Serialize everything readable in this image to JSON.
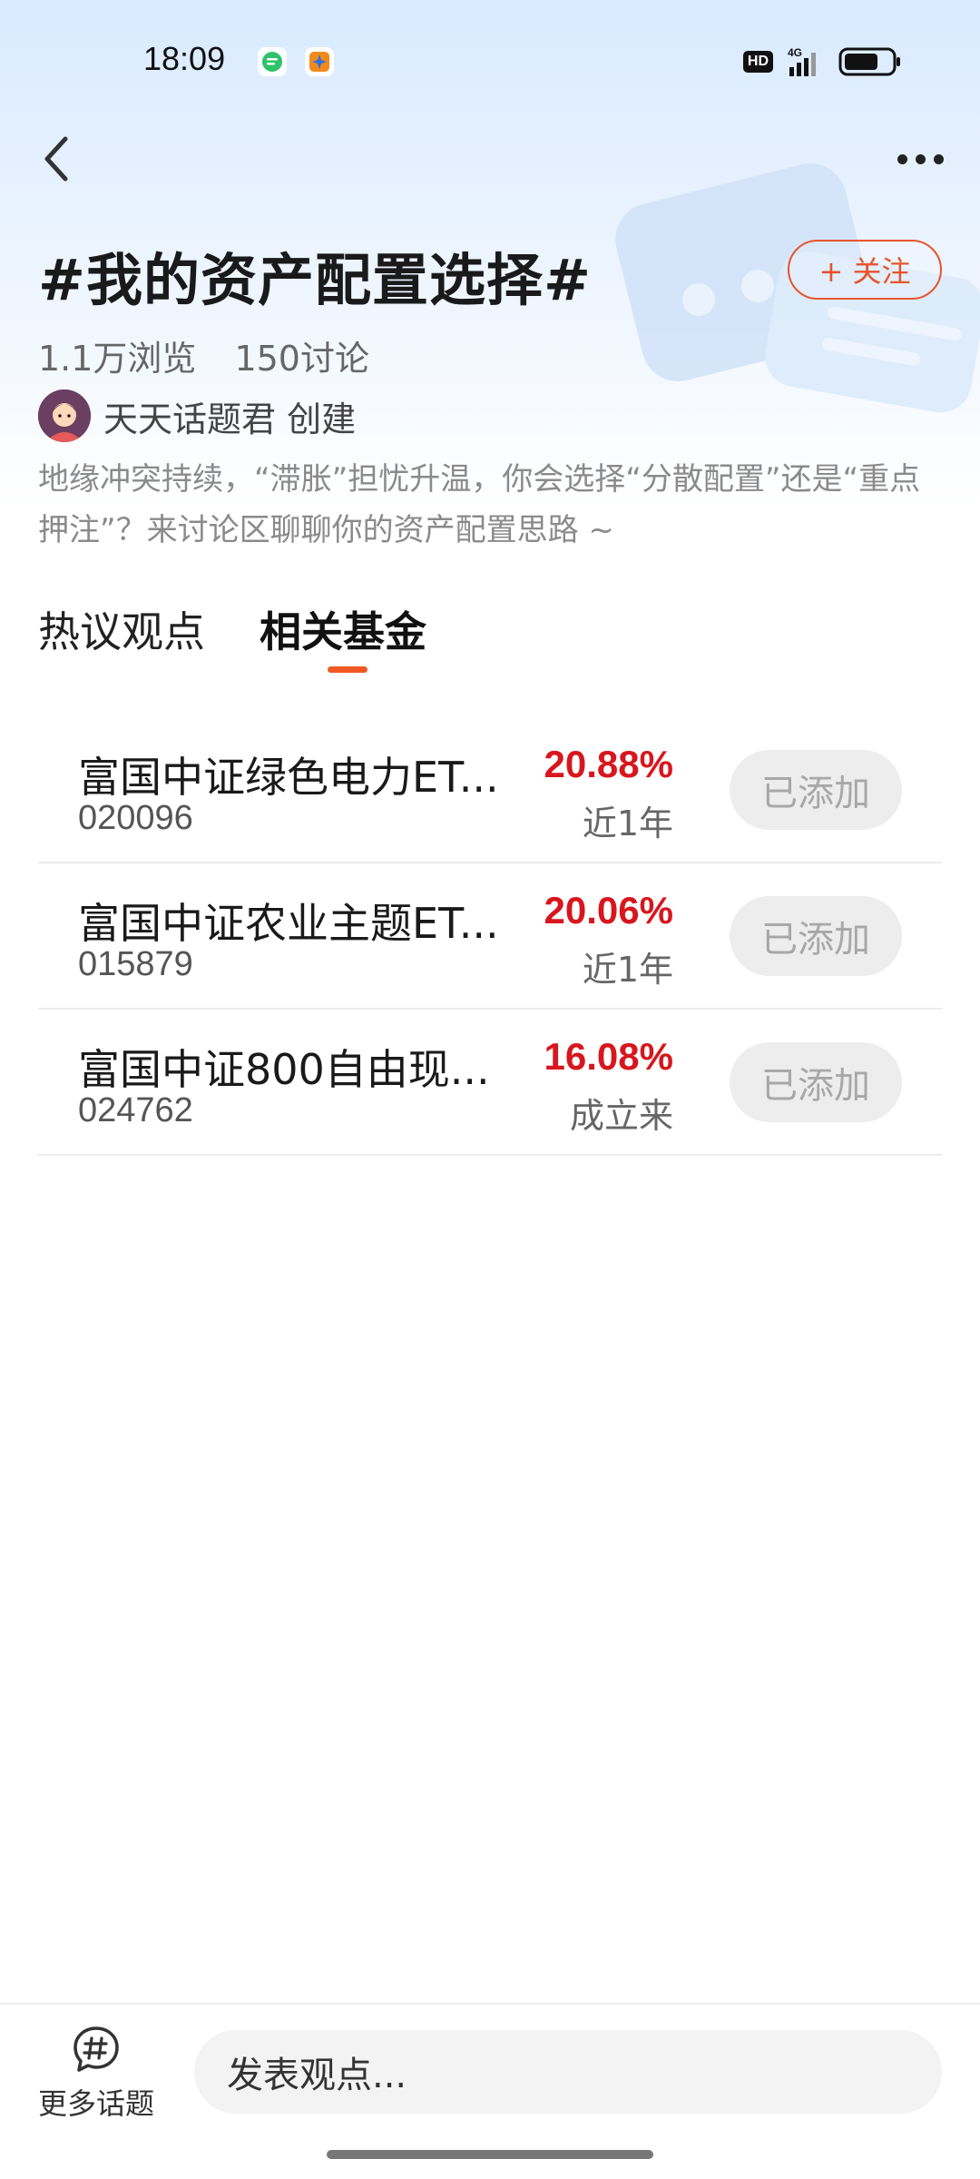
{
  "status_bar": {
    "time": "18:09",
    "hd_label": "HD",
    "network_label": "4G",
    "battery_level": 0.72
  },
  "topic": {
    "title": "#我的资产配置选择#",
    "follow_label": "+ 关注",
    "views": "1.1万浏览",
    "discussions": "150讨论",
    "creator": "天天话题君 创建",
    "description": "地缘冲突持续，“滞胀”担忧升温，你会选择“分散配置”还是“重点押注”？来讨论区聊聊你的资产配置思路 ~"
  },
  "tabs": [
    {
      "label": "热议观点",
      "active": false
    },
    {
      "label": "相关基金",
      "active": true
    }
  ],
  "funds": [
    {
      "name": "富国中证绿色电力ET...",
      "code": "020096",
      "return": "20.88%",
      "period": "近1年",
      "button": "已添加"
    },
    {
      "name": "富国中证农业主题ET...",
      "code": "015879",
      "return": "20.06%",
      "period": "近1年",
      "button": "已添加"
    },
    {
      "name": "富国中证800自由现...",
      "code": "024762",
      "return": "16.08%",
      "period": "成立来",
      "button": "已添加"
    }
  ],
  "bottom_bar": {
    "more_topics_label": "更多话题",
    "comment_placeholder": "发表观点..."
  },
  "colors": {
    "accent": "#f05a22",
    "follow": "#e8542b",
    "return_red": "#d8161d"
  }
}
